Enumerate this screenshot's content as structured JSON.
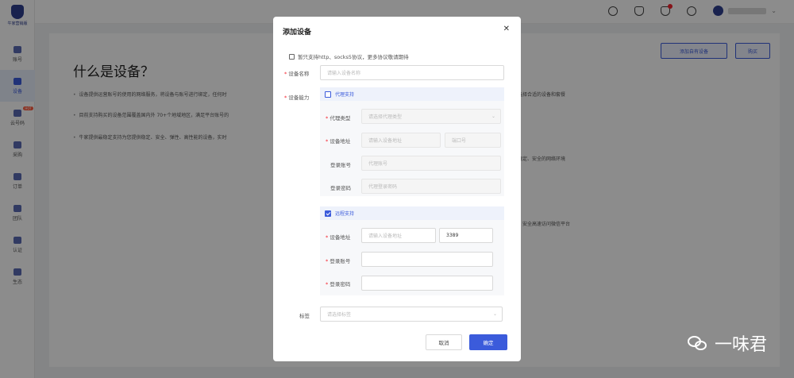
{
  "app": {
    "logo_text": "牛家营销版"
  },
  "sidebar": {
    "items": [
      {
        "label": "账号"
      },
      {
        "label": "设备"
      },
      {
        "label": "云号码",
        "badge": "HOT"
      },
      {
        "label": "采购"
      },
      {
        "label": "订单"
      },
      {
        "label": "团队"
      },
      {
        "label": "认证"
      },
      {
        "label": "生态"
      }
    ],
    "active_index": 1
  },
  "topbar": {
    "icons": [
      "download-icon",
      "headset-icon",
      "bell-icon",
      "help-icon"
    ]
  },
  "main": {
    "title": "什么是设备？",
    "add_own_device_label": "添加自有设备",
    "buy_label": "购买",
    "paragraphs": [
      "设备提供运营账号的使用的网络服务，将设备与账号进行绑定，任何时",
      "目前支持购买的设备范围覆盖国内外 70+个地域地区，满足平台账号的",
      "牛家提供最稳定支持为您提供稳定、安全、弹性、高性能的设备，实时"
    ],
    "right_fragments": [
      "选择合适的设备和套餐",
      "稳定、安全的网络环境",
      "，安全高速访问微信平台"
    ]
  },
  "modal": {
    "title": "添加设备",
    "notice": "暂只支持http、socks5协议，更多协议敬请期待",
    "device_name_label": "设备名称",
    "device_name_placeholder": "请输入设备名称",
    "capability_label": "设备能力",
    "proxy": {
      "checkbox_label": "代理支持",
      "checked": false,
      "type_label": "代理类型",
      "type_placeholder": "请选择代理类型",
      "address_label": "设备地址",
      "address_placeholder": "请输入设备地址",
      "port_placeholder": "端口号",
      "account_label": "登录账号",
      "account_placeholder": "代理账号",
      "password_label": "登录密码",
      "password_placeholder": "代理登录密码"
    },
    "remote": {
      "checkbox_label": "远程支持",
      "checked": true,
      "address_label": "设备地址",
      "address_placeholder": "请输入设备地址",
      "port_value": "3389",
      "account_label": "登录账号",
      "password_label": "登录密码"
    },
    "tag_label": "标签",
    "tag_placeholder": "请选择标签",
    "cancel_label": "取消",
    "ok_label": "确定"
  },
  "watermark": {
    "text": "一味君"
  },
  "colors": {
    "primary": "#3b5bdb",
    "required": "#f5222d"
  }
}
